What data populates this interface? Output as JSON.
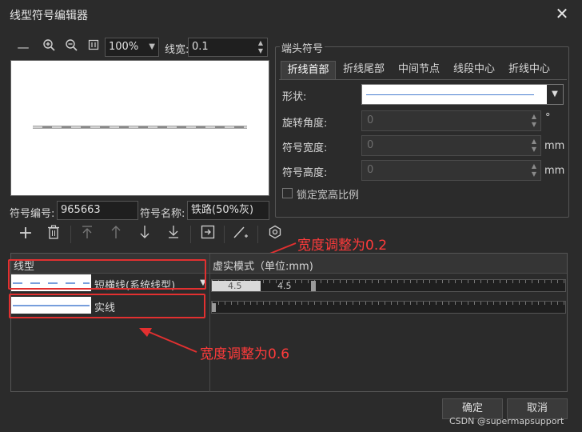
{
  "window": {
    "title": "线型符号编辑器",
    "close_glyph": "✕"
  },
  "toolbar": {
    "zoom_value": "100%",
    "line_width_label": "线宽:",
    "line_width_value": "0.1"
  },
  "symbol": {
    "id_label": "符号编号:",
    "id_value": "965663",
    "name_label": "符号名称:",
    "name_value": "铁路(50%灰)"
  },
  "arrow_group": {
    "title": "端头符号",
    "tabs": [
      {
        "label": "折线首部",
        "active": true
      },
      {
        "label": "折线尾部",
        "active": false
      },
      {
        "label": "中间节点",
        "active": false
      },
      {
        "label": "线段中心",
        "active": false
      },
      {
        "label": "折线中心",
        "active": false
      }
    ],
    "shape_label": "形状:",
    "rotation_label": "旋转角度:",
    "rotation_value": "0",
    "rotation_unit": "°",
    "width_label": "符号宽度:",
    "width_value": "0",
    "width_unit": "mm",
    "height_label": "符号高度:",
    "height_value": "0",
    "height_unit": "mm",
    "lock_label": "锁定宽高比例"
  },
  "grid": {
    "col_linetype": "线型",
    "col_dash": "虚实模式（单位:mm)",
    "rows": [
      {
        "name": "短横线(系统线型)",
        "dash_a": "4.5",
        "dash_b": "4.5"
      },
      {
        "name": "实线"
      }
    ]
  },
  "annotations": {
    "top": "宽度调整为0.2",
    "bottom": "宽度调整为0.6"
  },
  "buttons": {
    "ok": "确定",
    "cancel": "取消"
  },
  "watermark": "CSDN @supermapsupport",
  "colors": {
    "background": "#2b2b2b",
    "annotation": "#e23030",
    "accent_line": "#4a7fd0"
  }
}
